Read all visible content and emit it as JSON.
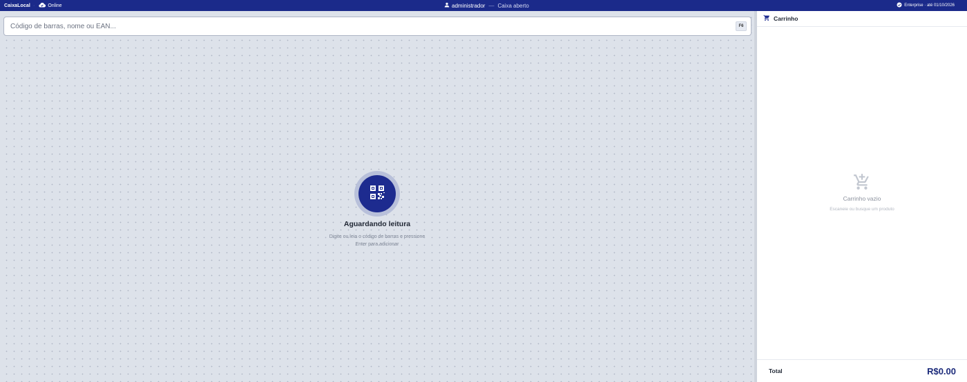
{
  "topbar": {
    "brand": "CaixaLocal",
    "separator": "·",
    "status": "Online",
    "user": "administrador",
    "user_separator": "—",
    "register_status": "Caixa aberto",
    "license": "Enterprise · até 01/10/2026"
  },
  "search": {
    "placeholder": "Código de barras, nome ou EAN...",
    "value": "",
    "shortcut": "F6"
  },
  "scanner": {
    "title": "Aguardando leitura",
    "subtitle_line1": "Digite ou leia o código de barras e pressione",
    "subtitle_line2": "Enter para adicionar"
  },
  "cart": {
    "title": "Carrinho",
    "empty_title": "Carrinho vazio",
    "empty_subtitle": "Escaneie ou busque um produto",
    "total_label": "Total",
    "total_value": "R$0.00"
  },
  "icons": {
    "status": "cloud-check-icon",
    "user": "user-icon",
    "license": "verified-check-icon",
    "scanner": "qr-code-icon",
    "cart": "shopping-cart-icon",
    "empty_cart": "cart-add-icon"
  },
  "colors": {
    "topbar": "#1b2a8a",
    "accent": "#1d2b8f",
    "background": "#dde2ea"
  }
}
